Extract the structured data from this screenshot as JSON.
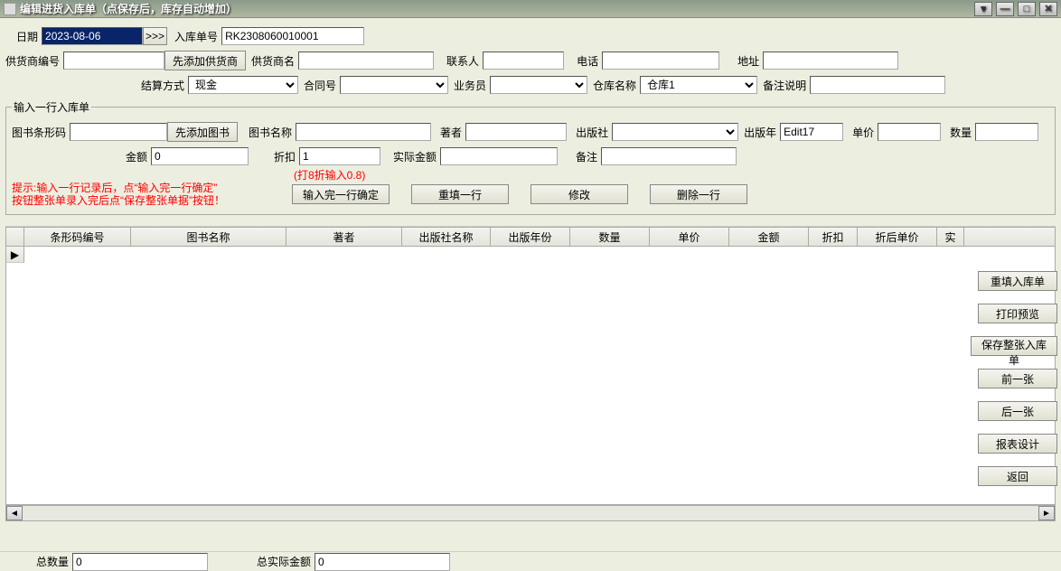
{
  "window": {
    "title": "编辑进货入库单（点保存后，库存自动增加）"
  },
  "header": {
    "date_label": "日期",
    "date_value": "2023-08-06",
    "date_btn": ">>>",
    "receipt_no_label": "入库单号",
    "receipt_no_value": "RK2308060010001"
  },
  "supplier": {
    "code_label": "供货商编号",
    "add_supplier_btn": "先添加供货商",
    "name_label": "供货商名",
    "contact_label": "联系人",
    "phone_label": "电话",
    "address_label": "地址"
  },
  "settlement": {
    "method_label": "结算方式",
    "method_value": "现金",
    "contract_label": "合同号",
    "clerk_label": "业务员",
    "warehouse_label": "仓库名称",
    "warehouse_value": "仓库1",
    "remark_label": "备注说明"
  },
  "lineEntry": {
    "legend": "输入一行入库单",
    "barcode_label": "图书条形码",
    "add_book_btn": "先添加图书",
    "bookname_label": "图书名称",
    "author_label": "著者",
    "publisher_label": "出版社",
    "pubyear_label": "出版年",
    "pubyear_value": "Edit17",
    "price_label": "单价",
    "qty_label": "数量",
    "amount_label": "金额",
    "amount_value": "0",
    "discount_label": "折扣",
    "discount_value": "1",
    "discount_hint": "(打8折输入0.8)",
    "real_amount_label": "实际金额",
    "note_label": "备注"
  },
  "hints": {
    "line1": "提示:输入一行记录后，点“输入完一行确定”",
    "line2": "按钮整张单录入完后点“保存整张单据”按钮！"
  },
  "lineActions": {
    "confirm": "输入完一行确定",
    "refill": "重填一行",
    "edit": "修改",
    "delete": "删除一行"
  },
  "table": {
    "cols": [
      "条形码编号",
      "图书名称",
      "著者",
      "出版社名称",
      "出版年份",
      "数量",
      "单价",
      "金额",
      "折扣",
      "折后单价",
      "实"
    ],
    "widths": [
      20,
      118,
      172,
      128,
      98,
      88,
      88,
      88,
      88,
      54,
      88,
      30
    ]
  },
  "sideBtns": {
    "refill": "重填入库单",
    "preview": "打印预览",
    "save": "保存整张入库单",
    "prev": "前一张",
    "next": "后一张",
    "report": "报表设计",
    "back": "返回"
  },
  "footer": {
    "total_qty_label": "总数量",
    "total_qty_value": "0",
    "total_amount_label": "总实际金额",
    "total_amount_value": "0"
  }
}
